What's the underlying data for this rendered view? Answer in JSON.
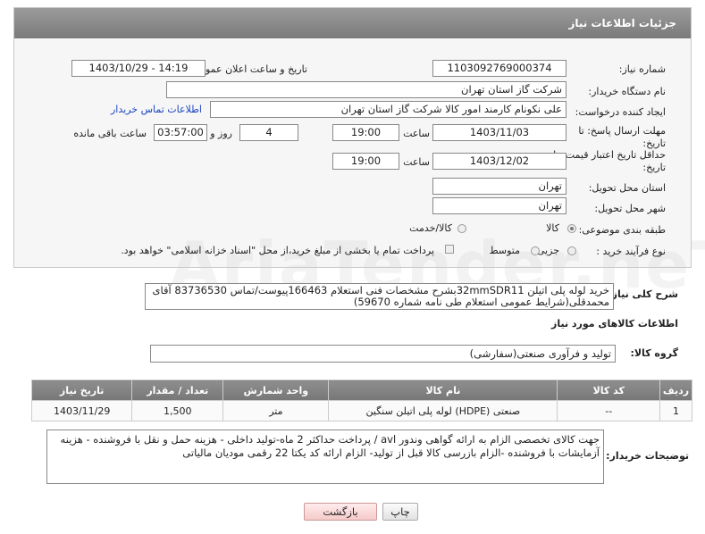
{
  "header": {
    "title": "جزئیات اطلاعات نیاز"
  },
  "fields": {
    "need_number_label": "شماره نیاز:",
    "need_number": "1103092769000374",
    "announce_datetime_label": "تاریخ و ساعت اعلان عمومی:",
    "announce_datetime": "1403/10/29 - 14:19",
    "buyer_org_label": "نام دستگاه خریدار:",
    "buyer_org": "شرکت گاز استان تهران",
    "requester_label": "ایجاد کننده درخواست:",
    "requester": "علی نکونام کارمند امور کالا شرکت گاز استان تهران",
    "buyer_contact_link": "اطلاعات تماس خریدار",
    "reply_deadline_label": "مهلت ارسال پاسخ: تا تاریخ:",
    "reply_date": "1403/11/03",
    "time_label": "ساعت",
    "reply_time": "19:00",
    "days_value": "4",
    "days_label": "روز و",
    "remaining_time": "03:57:00",
    "remaining_label": "ساعت باقی مانده",
    "price_validity_label": "حداقل تاریخ اعتبار قیمت: تا تاریخ:",
    "price_validity_date": "1403/12/02",
    "price_validity_time": "19:00",
    "delivery_province_label": "استان محل تحویل:",
    "delivery_province": "تهران",
    "delivery_city_label": "شهر محل تحویل:",
    "delivery_city": "تهران",
    "category_label": "طبقه بندی موضوعی:",
    "category_goods": "کالا",
    "category_goods_service": "کالا/خدمت",
    "purchase_process_label": "نوع فرآیند خرید :",
    "process_minor": "جزیی",
    "process_medium": "متوسط",
    "process_note": "پرداخت تمام یا بخشی از مبلغ خرید،از محل \"اسناد خزانه اسلامی\" خواهد بود."
  },
  "summary": {
    "label": "شرح کلی نیاز:",
    "text": "خرید لوله پلی اتیلن 32mmSDR11بشرح مشخصات فنی استعلام 166463پیوست/تماس 83736530 آقای محمدقلی(شرایط عمومی استعلام طی نامه شماره 59670)"
  },
  "goods_section": {
    "heading": "اطلاعات کالاهای مورد نیاز",
    "group_label": "گروه کالا:",
    "group_value": "تولید و فرآوری صنعتی(سفارشی)"
  },
  "table": {
    "headers": [
      "ردیف",
      "کد کالا",
      "نام کالا",
      "واحد شمارش",
      "تعداد / مقدار",
      "تاریخ نیاز"
    ],
    "rows": [
      [
        "1",
        "--",
        "لوله پلی اتیلن سنگین (HDPE) صنعتی",
        "متر",
        "1,500",
        "1403/11/29"
      ]
    ]
  },
  "buyer_notes": {
    "label": "توضیحات خریدار:",
    "text": "جهت کالای تخصصی الزام به ارائه گواهی وندور avl  / پرداخت حداکثر 2 ماه-تولید داخلی - هزینه حمل و نقل با فروشنده - هزینه آزمایشات با فروشنده -الزام بازرسی کالا قبل از تولید- الزام ارائه کد یکتا 22 رقمی مودیان مالیاتی"
  },
  "buttons": {
    "print": "چاپ",
    "back": "بازگشت"
  },
  "watermark": "AriaTender.neT"
}
